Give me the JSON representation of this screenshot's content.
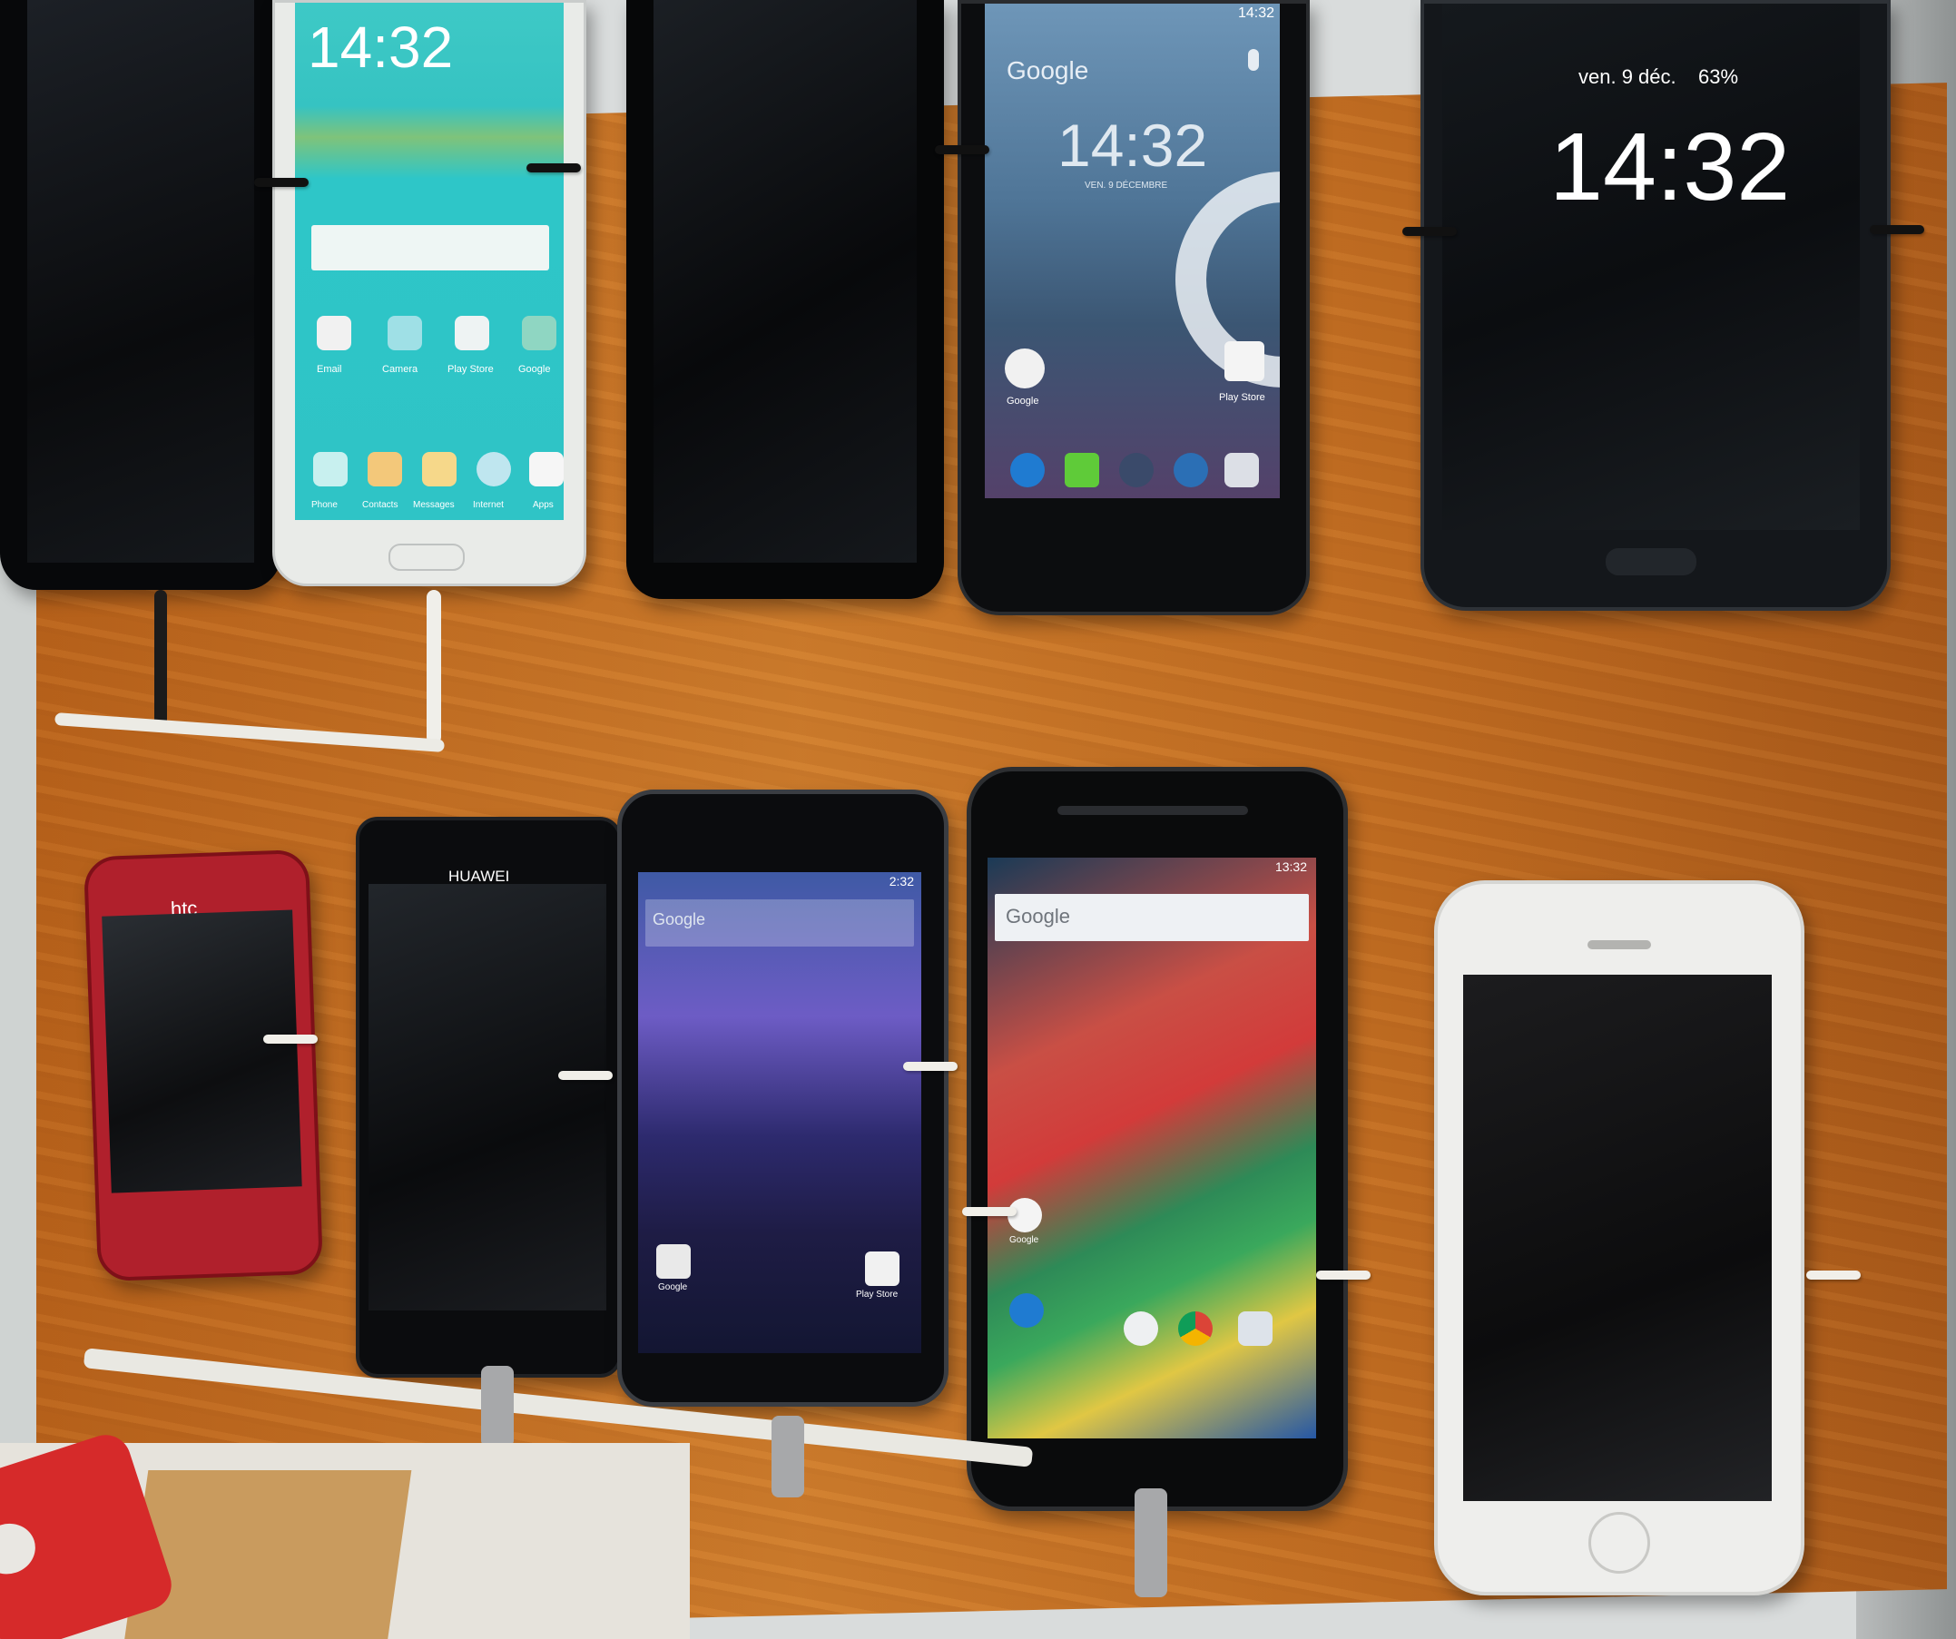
{
  "phones": {
    "samsung_top": {
      "time": "14:32",
      "dock_labels": [
        "Phone",
        "Contacts",
        "Messages",
        "Internet",
        "Apps"
      ],
      "app_labels": [
        "Email",
        "Camera",
        "Play Store",
        "Google"
      ]
    },
    "android_top": {
      "google": "Google",
      "time": "14:32",
      "date": "VEN. 9 DÉCEMBRE",
      "status_time": "14:32",
      "app_google": "Google",
      "app_play": "Play Store"
    },
    "samsung_aod": {
      "date": "ven. 9 déc.",
      "battery": "63%",
      "time": "14:32"
    },
    "htc": {
      "brand": "htc"
    },
    "huawei": {
      "brand": "HUAWEI"
    },
    "nexus": {
      "status_time": "2:32",
      "google": "Google",
      "app_google": "Google",
      "app_play": "Play Store"
    },
    "moto": {
      "status_time": "13:32",
      "google": "Google",
      "app_google": "Google"
    }
  }
}
